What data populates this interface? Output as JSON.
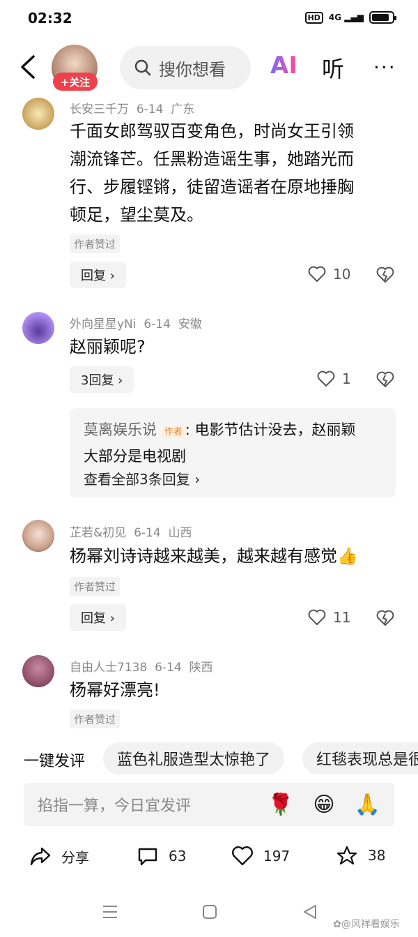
{
  "status": {
    "time": "02:32",
    "hd": "HD",
    "signal": "4G"
  },
  "header": {
    "follow_label": "+关注",
    "search_placeholder": "搜你想看",
    "ai_label": "AI",
    "listen_label": "听",
    "more_label": "···"
  },
  "comments": [
    {
      "user": "长安三千万",
      "date": "6-14",
      "region": "广东",
      "text_lines": [
        "千面女郎驾驭百变角色，时尚女王引领",
        "潮流锋芒。任黑粉造谣生事，她踏光而",
        "行、步履铿锵，徒留造谣者在原地捶胸",
        "顿足，望尘莫及。"
      ],
      "tag": "作者赞过",
      "reply_label": "回复 ›",
      "likes": "10"
    },
    {
      "user": "外向星星yNi",
      "date": "6-14",
      "region": "安徽",
      "text": "赵丽颖呢?",
      "reply_label": "3回复 ›",
      "likes": "1",
      "subreply": {
        "author": "莫离娱乐说",
        "author_tag": "作者",
        "text_line1": ": 电影节估计没去，赵丽颖",
        "text_line2": "大部分是电视剧",
        "view_all": "查看全部3条回复 ›"
      }
    },
    {
      "user": "芷若&初见",
      "date": "6-14",
      "region": "山西",
      "text": "杨幂刘诗诗越来越美，越来越有感觉",
      "emoji": "👍",
      "tag": "作者赞过",
      "reply_label": "回复 ›",
      "likes": "11"
    },
    {
      "user": "自由人士7138",
      "date": "6-14",
      "region": "陕西",
      "text": "杨幂好漂亮!",
      "tag": "作者赞过"
    }
  ],
  "quick_comment": {
    "label": "一键发评",
    "chips": [
      "蓝色礼服造型太惊艳了",
      "红毯表现总是很"
    ]
  },
  "input": {
    "placeholder": "掐指一算，今日宜发评",
    "emojis": [
      "🌹",
      "😁",
      "🙏"
    ]
  },
  "actions": {
    "share": "分享",
    "comments": "63",
    "likes": "197",
    "stars": "38"
  },
  "watermark": "风祥看娱乐",
  "colors": {
    "accent_red": "#f0404b",
    "ai_gradient_start": "#7a6cff",
    "ai_gradient_end": "#ff4d8d"
  }
}
